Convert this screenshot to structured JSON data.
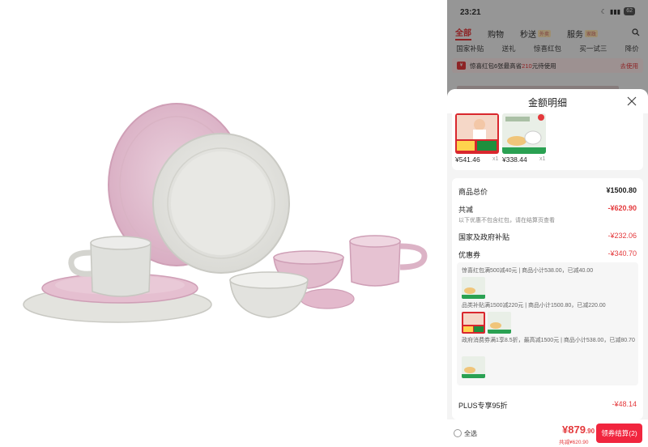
{
  "status": {
    "time": "23:21",
    "battery": "62"
  },
  "tabs": [
    {
      "label": "全部",
      "active": true
    },
    {
      "label": "购物"
    },
    {
      "label": "秒送",
      "badge": "外卖"
    },
    {
      "label": "服务",
      "badge": "家政"
    }
  ],
  "subtabs": [
    "国家补贴",
    "送礼",
    "惊喜红包",
    "买一试三",
    "降价"
  ],
  "coupon_strip": {
    "prefix": "惊喜红包",
    "text": "6张最高省",
    "amount": "210",
    "suffix": "元待使用",
    "action": "去使用"
  },
  "sheet": {
    "title": "金额明细",
    "items": [
      {
        "price": "¥541.46",
        "qty": "x1"
      },
      {
        "price": "¥338.44",
        "qty": "x1"
      }
    ],
    "total_label": "商品总价",
    "total_value": "¥1500.80",
    "reduce_label": "共减",
    "reduce_value": "-¥620.90",
    "reduce_note": "以下优惠不包含红包，请在结算页查看",
    "subsidy_label": "国家及政府补贴",
    "subsidy_value": "-¥232.06",
    "coupon_label": "优惠券",
    "coupon_value": "-¥340.70",
    "coupon_lines": [
      "惊喜红包满500减40元 | 商品小计538.00，已减40.00",
      "品类补贴满1500减220元 | 商品小计1500.80，已减220.00",
      "政府消费券满1享8.5折，最高减1500元 | 商品小计538.00，已减80.70"
    ],
    "plus_label": "PLUS专享95折",
    "plus_value": "-¥48.14"
  },
  "footer": {
    "select_all": "全选",
    "total_int": "¥879",
    "total_dec": ".90",
    "total_sub": "共减¥620.90",
    "checkout": "领券结算(2)"
  },
  "colors": {
    "accent": "#e4393c",
    "checkout": "#f1253e",
    "pink_plate": "#e3bfd0",
    "gray_plate": "#e6e6e2"
  }
}
